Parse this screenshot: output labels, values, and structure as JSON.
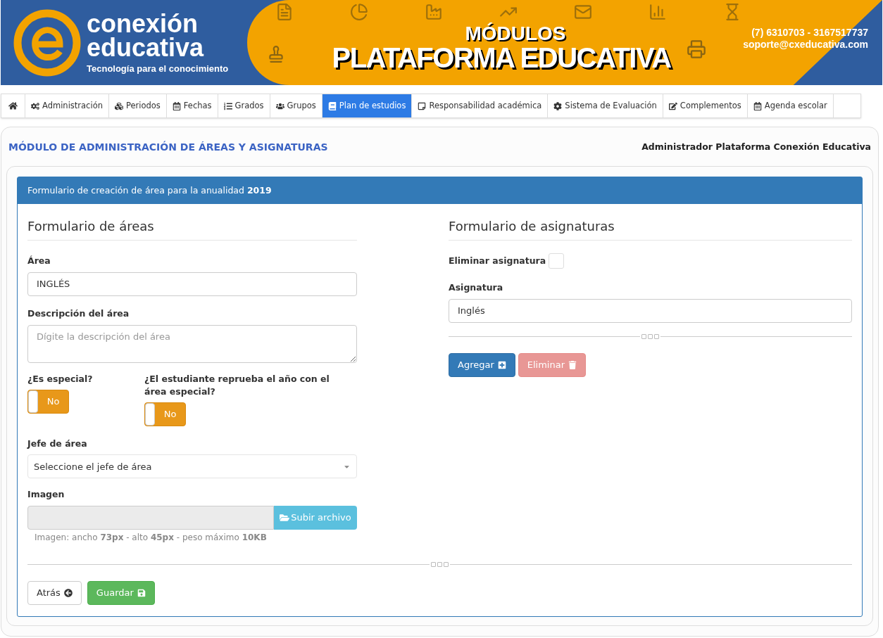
{
  "banner": {
    "logo_line1": "conexión",
    "logo_line2": "educativa",
    "tagline": "Tecnología para el conocimiento",
    "kicker": "MÓDULOS",
    "title": "PLATAFORMA EDUCATIVA",
    "phone": "(7) 6310703 - 3167517737",
    "email": "soporte@cxeducativa.com"
  },
  "nav": [
    {
      "label": "Administración",
      "selected": false
    },
    {
      "label": "Periodos",
      "selected": false
    },
    {
      "label": "Fechas",
      "selected": false
    },
    {
      "label": "Grados",
      "selected": false
    },
    {
      "label": "Grupos",
      "selected": false
    },
    {
      "label": "Plan de estudios",
      "selected": true
    },
    {
      "label": "Responsabilidad académica",
      "selected": false
    },
    {
      "label": "Sistema de Evaluación",
      "selected": false
    },
    {
      "label": "Complementos",
      "selected": false
    },
    {
      "label": "Agenda escolar",
      "selected": false
    }
  ],
  "page": {
    "title": "MÓDULO DE ADMINISTRACIÓN DE ÁREAS Y ASIGNATURAS",
    "user": "Administrador Plataforma Conexión Educativa"
  },
  "panel": {
    "heading": "Formulario de creación de área para la anualidad **2019**"
  },
  "areas": {
    "title": "Formulario de áreas",
    "area_label": "Área",
    "area_value": "INGLÉS",
    "description_label": "Descripción del área",
    "description_placeholder": "Dígite la descripción del área",
    "toggles": [
      {
        "label": "¿Es especial?",
        "text": "No",
        "on": false
      },
      {
        "label": "¿El estudiante reprueba el año con el área especial?",
        "text": "No",
        "on": false
      }
    ],
    "head_label": "Jefe de área",
    "head_placeholder": "Seleccione el jefe de área",
    "image_label": "Imagen",
    "upload_button": "Subir archivo",
    "image_hint": "Imagen: ancho **73px** - alto **45px** - peso máximo **10KB**"
  },
  "subjects": {
    "title": "Formulario de asignaturas",
    "delete_label": "Eliminar asignatura",
    "delete_checked": false,
    "subject_label": "Asignatura",
    "subject_value": "Inglés",
    "buttons": [
      {
        "label": "Agregar",
        "kind": "add",
        "disabled": false
      },
      {
        "label": "Eliminar",
        "kind": "delete",
        "disabled": true
      }
    ]
  },
  "footer_buttons": [
    {
      "label": "Atrás",
      "kind": "back"
    },
    {
      "label": "Guardar",
      "kind": "save"
    }
  ]
}
